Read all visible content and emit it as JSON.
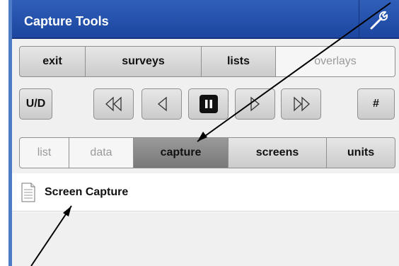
{
  "window": {
    "title": "Capture Tools"
  },
  "top_segments": [
    {
      "label": "exit",
      "state": "normal"
    },
    {
      "label": "surveys",
      "state": "normal"
    },
    {
      "label": "lists",
      "state": "normal"
    },
    {
      "label": "overlays",
      "state": "disabled"
    }
  ],
  "controls": {
    "ud_label": "U/D",
    "hash_label": "#",
    "media_icons": [
      "rewind-icon",
      "step-back-icon",
      "pause-icon",
      "step-forward-icon",
      "fast-forward-icon"
    ]
  },
  "bottom_segments": [
    {
      "label": "list",
      "state": "disabled"
    },
    {
      "label": "data",
      "state": "disabled"
    },
    {
      "label": "capture",
      "state": "active"
    },
    {
      "label": "screens",
      "state": "normal"
    },
    {
      "label": "units",
      "state": "normal"
    }
  ],
  "list_items": [
    {
      "label": "Screen Capture",
      "icon": "document-icon"
    }
  ],
  "colors": {
    "title_bar": "#2a55b0",
    "accent_stripe": "#4d7cc6",
    "active_segment": "#888888"
  }
}
